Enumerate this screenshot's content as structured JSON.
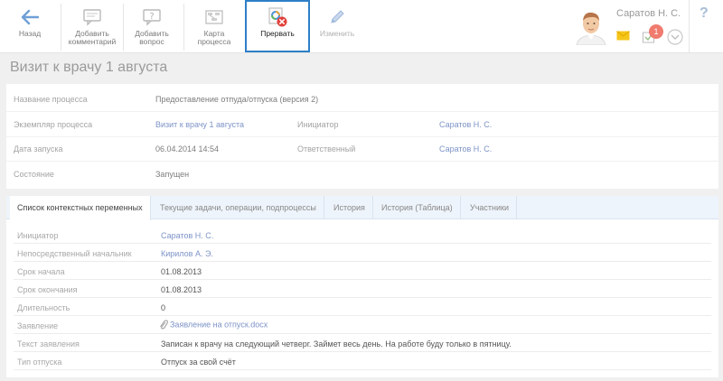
{
  "toolbar": {
    "back": "Назад",
    "add_comment_1": "Добавить",
    "add_comment_2": "комментарий",
    "add_question_1": "Добавить",
    "add_question_2": "вопрос",
    "process_map_1": "Карта",
    "process_map_2": "процесса",
    "interrupt": "Прервать",
    "edit": "Изменить"
  },
  "header": {
    "user_name": "Саратов Н. С.",
    "notifications_count": "1",
    "help": "?"
  },
  "page": {
    "title": "Визит к врачу 1 августа"
  },
  "properties": {
    "process_name_label": "Название процесса",
    "process_name_value": "Предоставление отпуда/отпуска (версия 2)",
    "instance_label": "Экземпляр процесса",
    "instance_value": "Визит к врачу 1 августа",
    "initiator_label": "Инициатор",
    "initiator_value": "Саратов Н. С.",
    "start_date_label": "Дата запуска",
    "start_date_value": "06.04.2014 14:54",
    "responsible_label": "Ответственный",
    "responsible_value": "Саратов Н. С.",
    "state_label": "Состояние",
    "state_value": "Запущен"
  },
  "tabs": [
    "Список контекстных переменных",
    "Текущие задачи, операции, подпроцессы",
    "История",
    "История (Таблица)",
    "Участники"
  ],
  "variables": [
    {
      "key": "Инициатор",
      "value": "Саратов Н. С."
    },
    {
      "key": "Непосредственный начальник",
      "value": "Кирилов А. Э."
    },
    {
      "key": "Срок начала",
      "value": "01.08.2013"
    },
    {
      "key": "Срок окончания",
      "value": "01.08.2013"
    },
    {
      "key": "Длительность",
      "value": "0"
    },
    {
      "key": "Заявление",
      "value": "Заявление на отпуск.docx"
    },
    {
      "key": "Текст заявления",
      "value": "Записан к врачу на следующий четверг. Займет весь день. На работе буду только в пятницу."
    },
    {
      "key": "Тип отпуска",
      "value": "Отпуск за свой счёт"
    }
  ],
  "colors": {
    "accent": "#2e7fc7",
    "link": "#7d93c7",
    "badge": "#f07b6e",
    "tabs_bg": "#eef4fb"
  },
  "icons": {
    "back": "arrow-left-icon",
    "comment": "comment-icon",
    "question": "question-icon",
    "map": "process-map-icon",
    "interrupt": "interrupt-icon",
    "edit": "pencil-icon",
    "mail": "mail-icon",
    "tasks": "tasks-icon",
    "dropdown": "chevron-down-icon",
    "attachment": "paperclip-icon"
  }
}
